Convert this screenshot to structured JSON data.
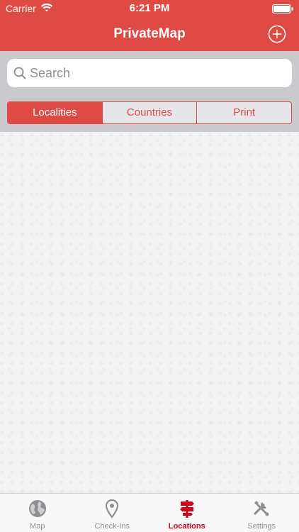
{
  "status_bar": {
    "carrier": "Carrier",
    "time": "6:21 PM"
  },
  "nav": {
    "title": "PrivateMap",
    "add_icon": "plus-circle-icon"
  },
  "search": {
    "placeholder": "Search",
    "value": ""
  },
  "segments": [
    {
      "label": "Localities",
      "selected": true
    },
    {
      "label": "Countries",
      "selected": false
    },
    {
      "label": "Print",
      "selected": false
    }
  ],
  "tabs": [
    {
      "label": "Map",
      "icon": "globe-icon",
      "active": false
    },
    {
      "label": "Check-Ins",
      "icon": "location-pin-icon",
      "active": false
    },
    {
      "label": "Locations",
      "icon": "signpost-icon",
      "active": true
    },
    {
      "label": "Settings",
      "icon": "tools-icon",
      "active": false
    }
  ],
  "colors": {
    "accent": "#e04a44",
    "active_tab": "#d0021b",
    "inactive_tab": "#8e8e93"
  }
}
